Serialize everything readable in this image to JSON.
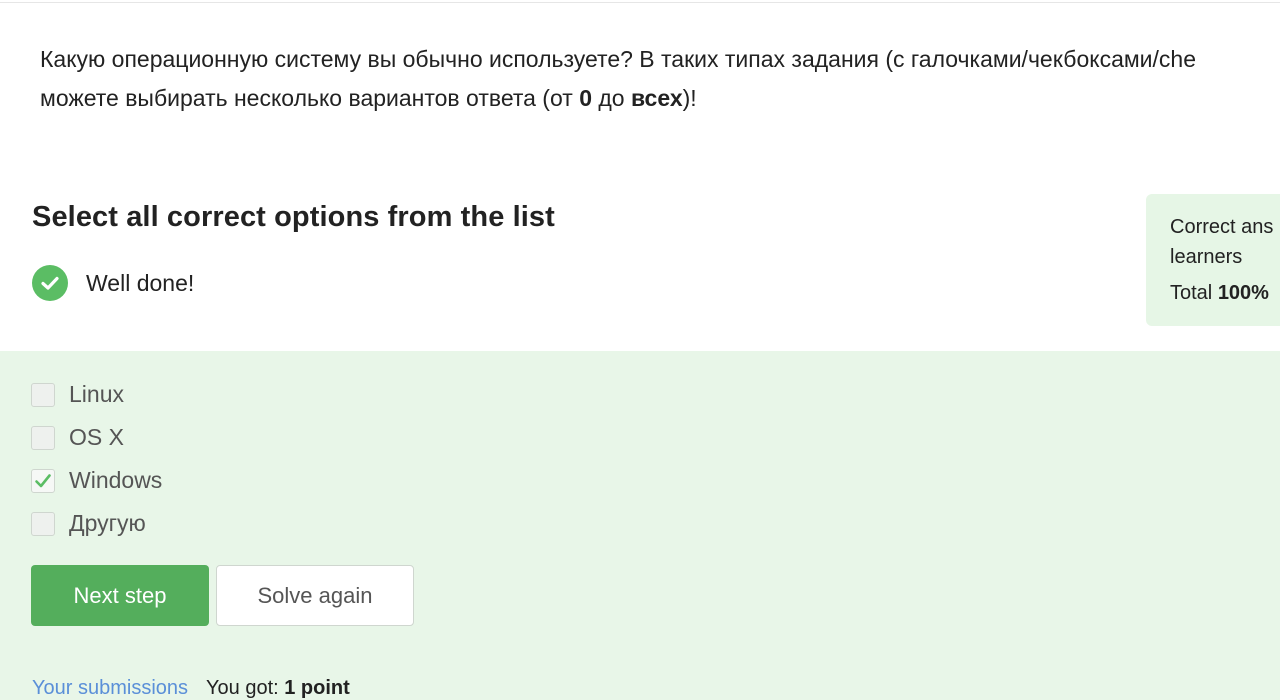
{
  "question": {
    "text_part1": "Какую операционную систему вы обычно используете? В таких типах задания (с галочками/чекбоксами/che",
    "text_part2": "можете выбирать несколько вариантов ответа (от ",
    "bold_from": "0",
    "text_part3": " до ",
    "bold_to": "всех",
    "text_part4": ")!"
  },
  "task": {
    "heading": "Select all correct options from the list",
    "status_text": "Well done!",
    "status_icon": "check-circle-icon",
    "status_color": "#5bbd64"
  },
  "stats": {
    "line1": "Correct ans",
    "line2": "learners",
    "total_label": "Total ",
    "total_value": "100%"
  },
  "options": [
    {
      "label": "Linux",
      "checked": false
    },
    {
      "label": "OS X",
      "checked": false
    },
    {
      "label": "Windows",
      "checked": true
    },
    {
      "label": "Другую",
      "checked": false
    }
  ],
  "buttons": {
    "next_step": "Next step",
    "solve_again": "Solve again"
  },
  "footer": {
    "submissions_link": "Your submissions",
    "got_label": "You got: ",
    "got_value": "1 point"
  },
  "colors": {
    "accent_green": "#54ae5c",
    "panel_bg": "#e8f6e8",
    "link_blue": "#5a8fd8"
  }
}
